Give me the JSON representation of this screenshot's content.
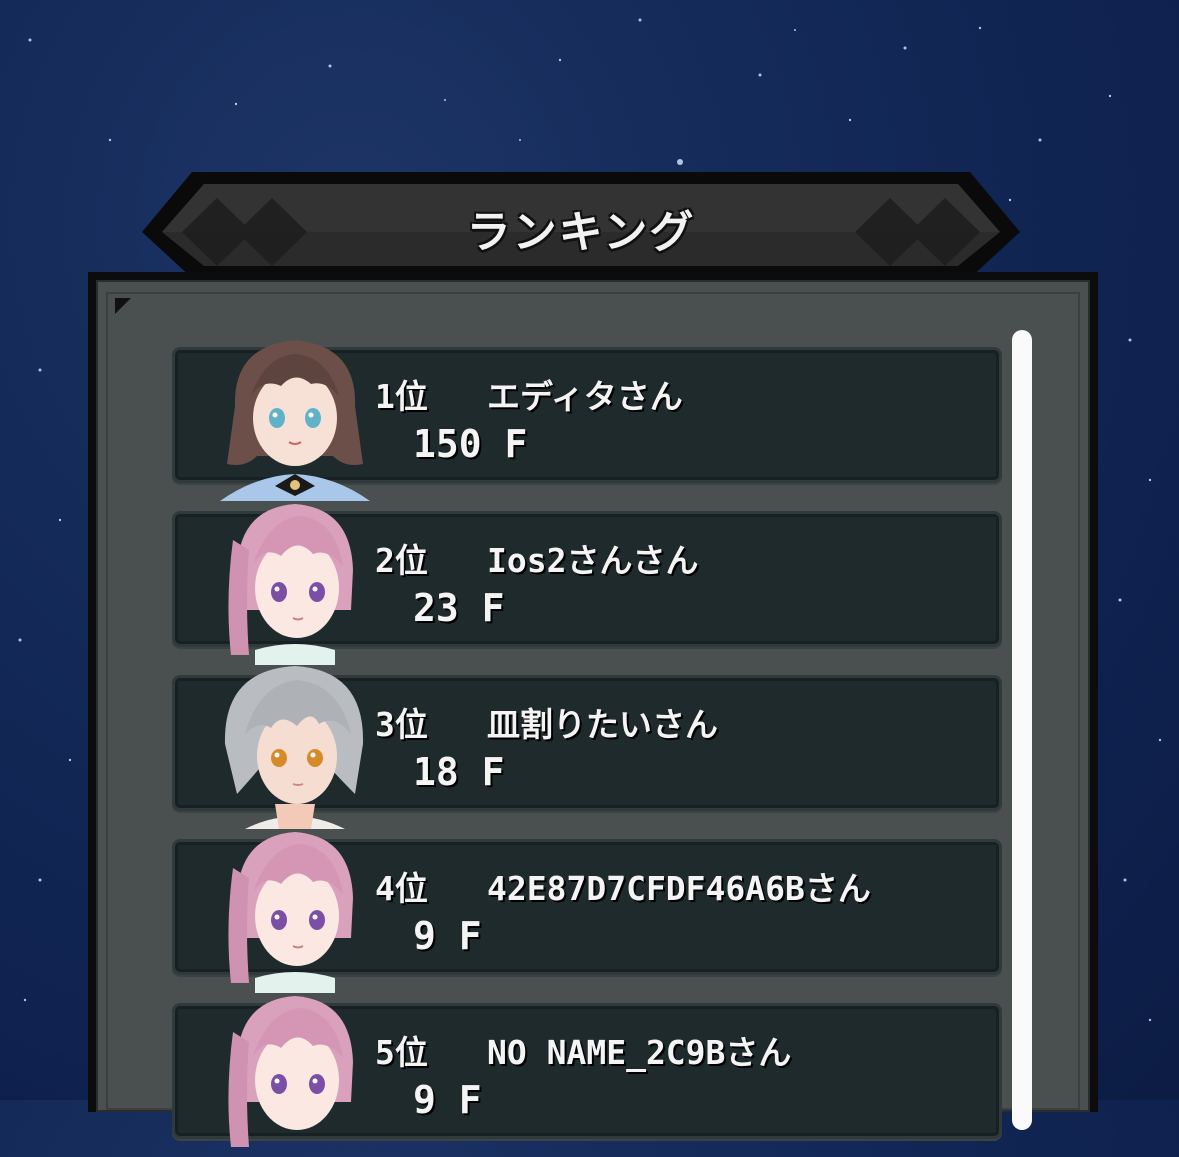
{
  "title": "ランキング",
  "rankings": [
    {
      "rank": "1位",
      "name": "エディタさん",
      "score": "150 F",
      "avatar": "brown-hair-girl-avatar"
    },
    {
      "rank": "2位",
      "name": "Ios2さんさん",
      "score": "23 F",
      "avatar": "pink-hair-girl-avatar"
    },
    {
      "rank": "3位",
      "name": "皿割りたいさん",
      "score": "18 F",
      "avatar": "silver-hair-boy-avatar"
    },
    {
      "rank": "4位",
      "name": "42E87D7CFDF46A6Bさん",
      "score": "9 F",
      "avatar": "pink-hair-girl-avatar"
    },
    {
      "rank": "5位",
      "name": "NO NAME_2C9Bさん",
      "score": "9 F",
      "avatar": "pink-hair-girl-avatar"
    }
  ],
  "colors": {
    "background": "#142a58",
    "panel": "#4a4f4f",
    "row": "#1f2a2c",
    "text": "#f4f4f4"
  }
}
